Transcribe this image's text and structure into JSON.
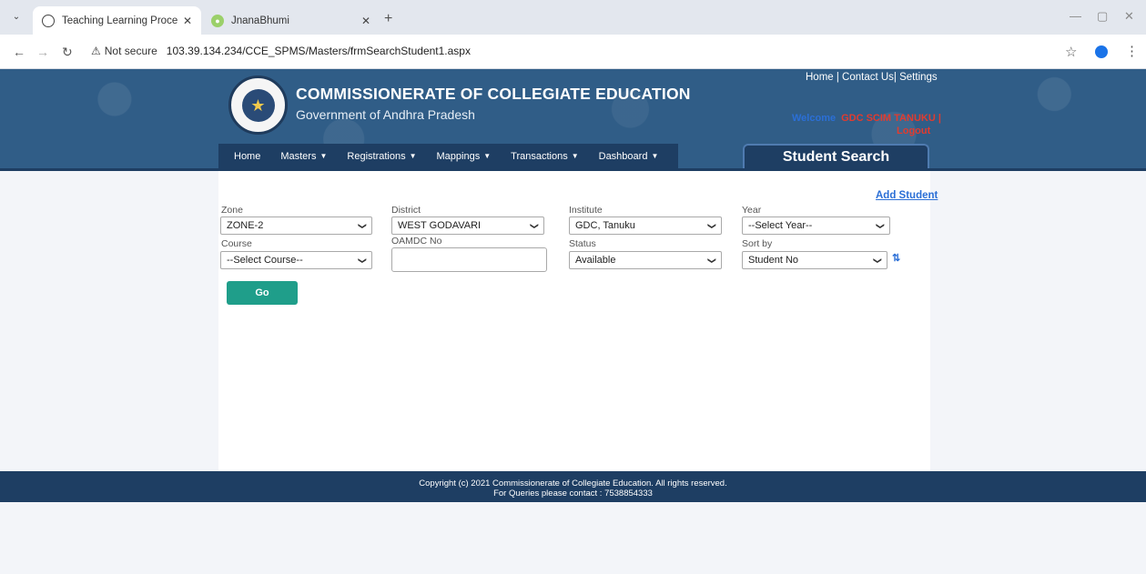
{
  "browser": {
    "tabs": [
      {
        "label": "Teaching Learning Process Mon",
        "close": "✕"
      },
      {
        "label": "JnanaBhumi",
        "close": "✕"
      }
    ],
    "new_tab": "+",
    "not_secure": "Not secure",
    "url": "103.39.134.234/CCE_SPMS/Masters/frmSearchStudent1.aspx"
  },
  "header": {
    "title": "COMMISSIONERATE OF COLLEGIATE EDUCATION",
    "subtitle": "Government of Andhra Pradesh",
    "links": "Home | Contact Us| Settings",
    "welcome_label": "Welcome",
    "username": "GDC SCIM TANUKU |",
    "logout": "Logout"
  },
  "nav": {
    "items": [
      "Home",
      "Masters",
      "Registrations",
      "Mappings",
      "Transactions",
      "Dashboard"
    ],
    "page_title": "Student Search"
  },
  "form": {
    "add_student": "Add Student",
    "zone": {
      "label": "Zone",
      "value": "ZONE-2"
    },
    "district": {
      "label": "District",
      "value": "WEST GODAVARI"
    },
    "institute": {
      "label": "Institute",
      "value": "GDC, Tanuku"
    },
    "year": {
      "label": "Year",
      "value": "--Select Year--"
    },
    "course": {
      "label": "Course",
      "value": "--Select Course--"
    },
    "oamdc": {
      "label": "OAMDC No",
      "value": ""
    },
    "status": {
      "label": "Status",
      "value": "Available"
    },
    "sortby": {
      "label": "Sort by",
      "value": "Student No"
    },
    "go": "Go"
  },
  "footer": {
    "line1": "Copyright (c) 2021 Commissionerate of Collegiate Education. All rights reserved.",
    "line2": "For Queries please contact : 7538854333"
  }
}
